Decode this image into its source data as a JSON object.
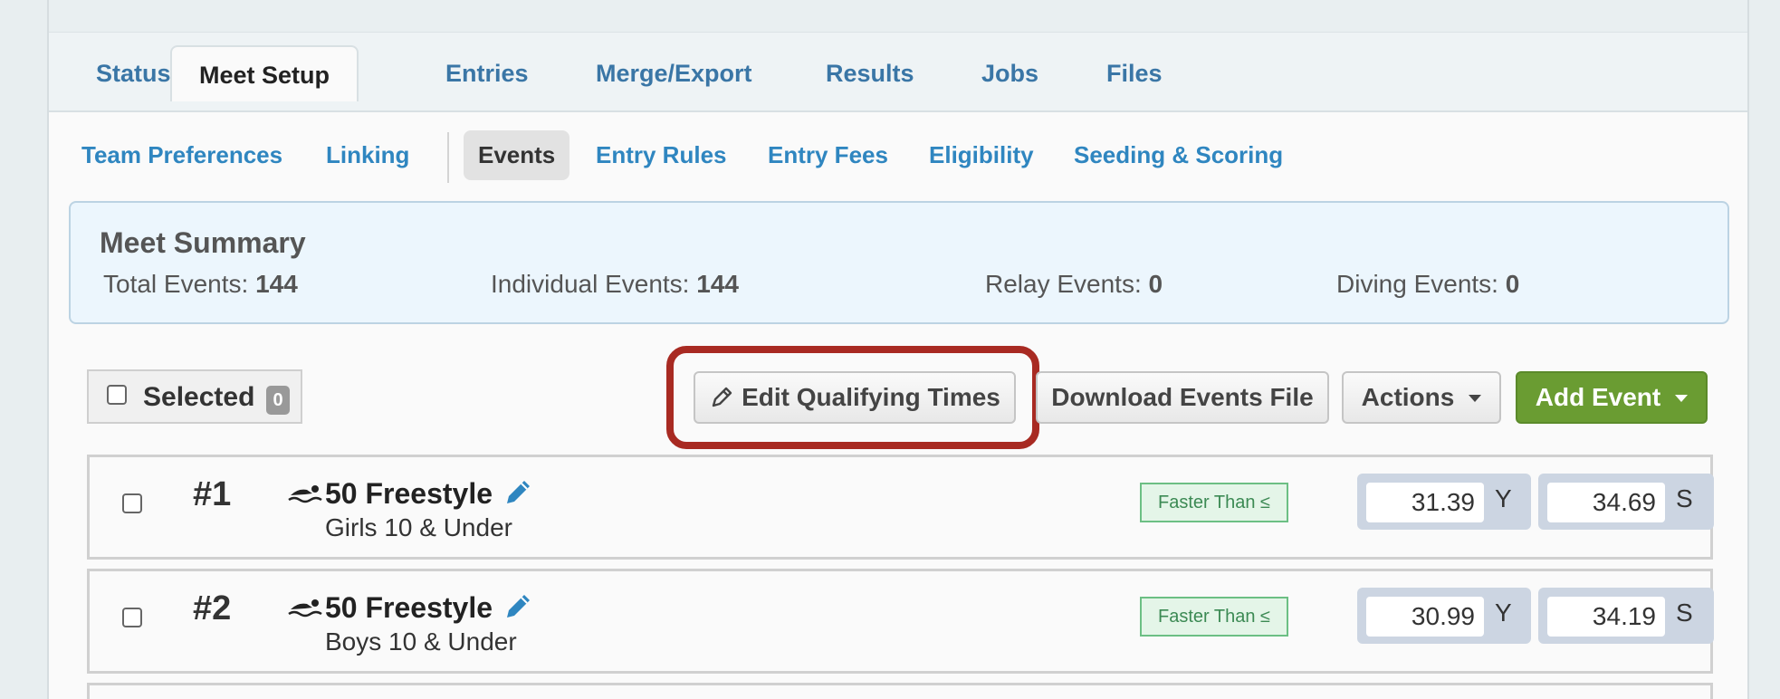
{
  "tabs": [
    "Status",
    "Meet Setup",
    "Entries",
    "Merge/Export",
    "Results",
    "Jobs",
    "Files"
  ],
  "active_tab": "Meet Setup",
  "subnav": {
    "items": [
      "Team Preferences",
      "Linking",
      "Events",
      "Entry Rules",
      "Entry Fees",
      "Eligibility",
      "Seeding & Scoring"
    ],
    "active": "Events"
  },
  "summary": {
    "title": "Meet Summary",
    "total_label": "Total Events:",
    "total_value": "144",
    "individual_label": "Individual Events:",
    "individual_value": "144",
    "relay_label": "Relay Events:",
    "relay_value": "0",
    "diving_label": "Diving Events:",
    "diving_value": "0"
  },
  "toolbar": {
    "selected_label": "Selected",
    "selected_count": "0",
    "edit_qualifying_label": "Edit Qualifying Times",
    "download_label": "Download Events File",
    "actions_label": "Actions",
    "add_event_label": "Add Event"
  },
  "events": [
    {
      "number": "#1",
      "name": "50 Freestyle",
      "group": "Girls 10 & Under",
      "comparison": "Faster Than ≤",
      "time_y": "31.39",
      "unit_y": "Y",
      "time_s": "34.69",
      "unit_s": "S"
    },
    {
      "number": "#2",
      "name": "50 Freestyle",
      "group": "Boys 10 & Under",
      "comparison": "Faster Than ≤",
      "time_y": "30.99",
      "unit_y": "Y",
      "time_s": "34.19",
      "unit_s": "S"
    }
  ],
  "colors": {
    "highlight": "#a82a22",
    "link": "#2f86c0",
    "green_button": "#6a9c32"
  }
}
